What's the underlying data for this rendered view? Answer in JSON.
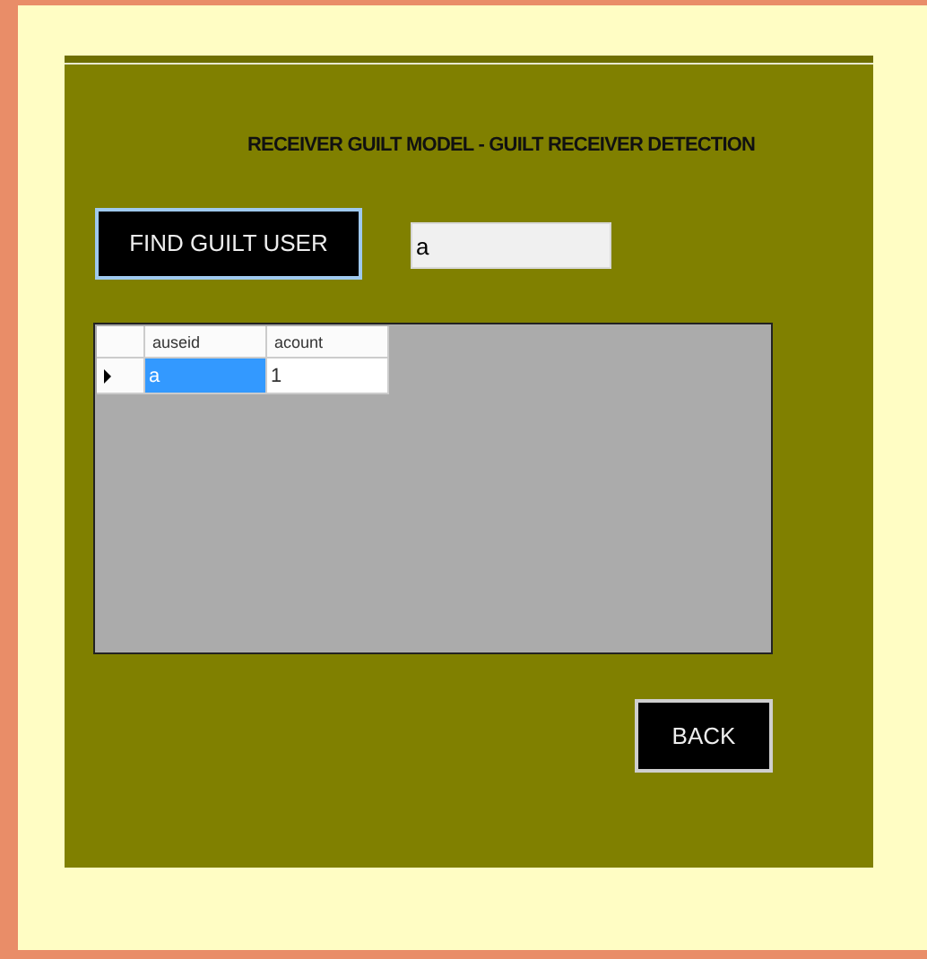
{
  "title": "RECEIVER GUILT MODEL - GUILT RECEIVER DETECTION",
  "find_button": "FIND GUILT USER",
  "search": {
    "value": "a"
  },
  "table": {
    "columns": [
      "auseid",
      "acount"
    ],
    "rows": [
      {
        "current": true,
        "cells": [
          {
            "text": "a",
            "selected": true
          },
          {
            "text": "1",
            "selected": false
          }
        ]
      }
    ]
  },
  "back_button": "BACK"
}
